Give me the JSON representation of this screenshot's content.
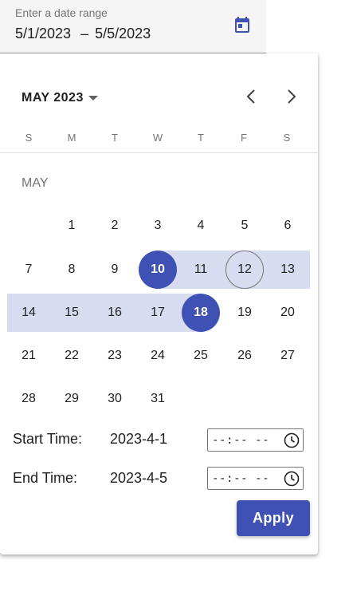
{
  "date_field": {
    "label": "Enter a date range",
    "start": "5/1/2023",
    "separator": "–",
    "end": "5/5/2023"
  },
  "calendar": {
    "period_label": "MAY 2023",
    "weekdays": [
      "S",
      "M",
      "T",
      "W",
      "T",
      "F",
      "S"
    ],
    "month_label": "MAY",
    "days": [
      "1",
      "2",
      "3",
      "4",
      "5",
      "6",
      "7",
      "8",
      "9",
      "10",
      "11",
      "12",
      "13",
      "14",
      "15",
      "16",
      "17",
      "18",
      "19",
      "20",
      "21",
      "22",
      "23",
      "24",
      "25",
      "26",
      "27",
      "28",
      "29",
      "30",
      "31"
    ],
    "range_start": 10,
    "range_end": 18,
    "today": 12
  },
  "start_time": {
    "label": "Start Time:",
    "date": "2023-4-1",
    "value": "--:-- --"
  },
  "end_time": {
    "label": "End Time:",
    "date": "2023-4-5",
    "value": "--:-- --"
  },
  "apply_label": "Apply",
  "colors": {
    "primary": "#3f51b5",
    "range_fill": "#d8dcf0"
  },
  "icons": {
    "date_field": "calendar-icon",
    "period": "caret-down-icon",
    "prev": "chevron-left-icon",
    "next": "chevron-right-icon",
    "time": "clock-icon"
  }
}
